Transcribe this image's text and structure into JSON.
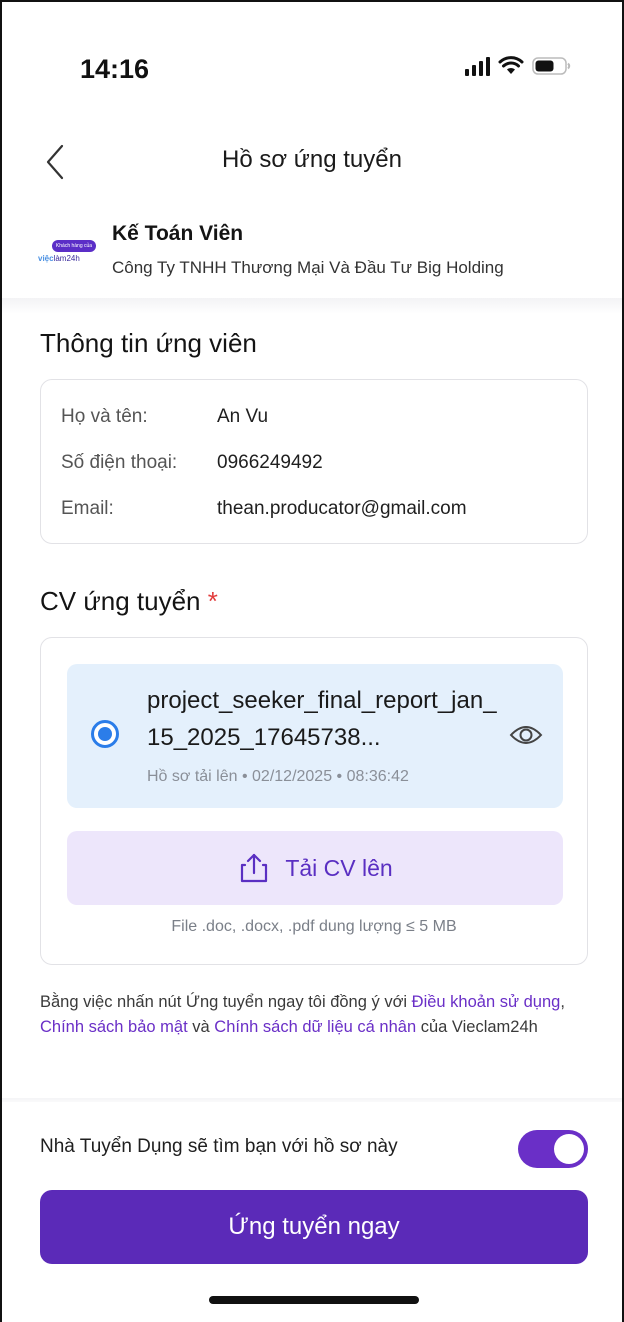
{
  "status_bar": {
    "time": "14:16"
  },
  "header": {
    "title": "Hồ sơ ứng tuyển"
  },
  "job": {
    "title": "Kế Toán Viên",
    "company": "Công Ty TNHH Thương Mại Và Đầu Tư Big Holding",
    "logo_badge": "Khách hàng của",
    "logo_brand_prefix": "việc",
    "logo_brand_suffix": "làm24h"
  },
  "candidate": {
    "section_title": "Thông tin ứng viên",
    "rows": [
      {
        "label": "Họ và tên:",
        "value": "An Vu"
      },
      {
        "label": "Số điện thoại:",
        "value": "0966249492"
      },
      {
        "label": "Email:",
        "value": "thean.producator@gmail.com"
      }
    ]
  },
  "cv": {
    "section_title": "CV ứng tuyển",
    "required_mark": "*",
    "file_name": "project_seeker_final_report_jan_15_2025_17645738...",
    "file_meta": "Hồ sơ tải lên • 02/12/2025 • 08:36:42",
    "selected": true,
    "upload_label": "Tải CV lên",
    "upload_hint": "File .doc, .docx, .pdf dung lượng ≤ 5 MB"
  },
  "terms": {
    "prefix": "Bằng việc nhấn nút Ứng tuyển ngay tôi đồng ý với ",
    "link_terms": "Điều khoản sử dụng",
    "sep1": ", ",
    "link_privacy": "Chính sách bảo mật",
    "sep2": " và ",
    "link_data": "Chính sách dữ liệu cá nhân",
    "suffix": " của Vieclam24h"
  },
  "bottom": {
    "toggle_label": "Nhà Tuyển Dụng sẽ tìm bạn với hồ sơ này",
    "toggle_on": true,
    "apply_label": "Ứng tuyển ngay"
  },
  "colors": {
    "primary": "#5b2ab8",
    "accent_purple": "#6a2fc7",
    "radio_blue": "#2b7de9",
    "cv_selected_bg": "#e4f0fc",
    "upload_bg": "#ede6fb",
    "required": "#e23b3b"
  }
}
